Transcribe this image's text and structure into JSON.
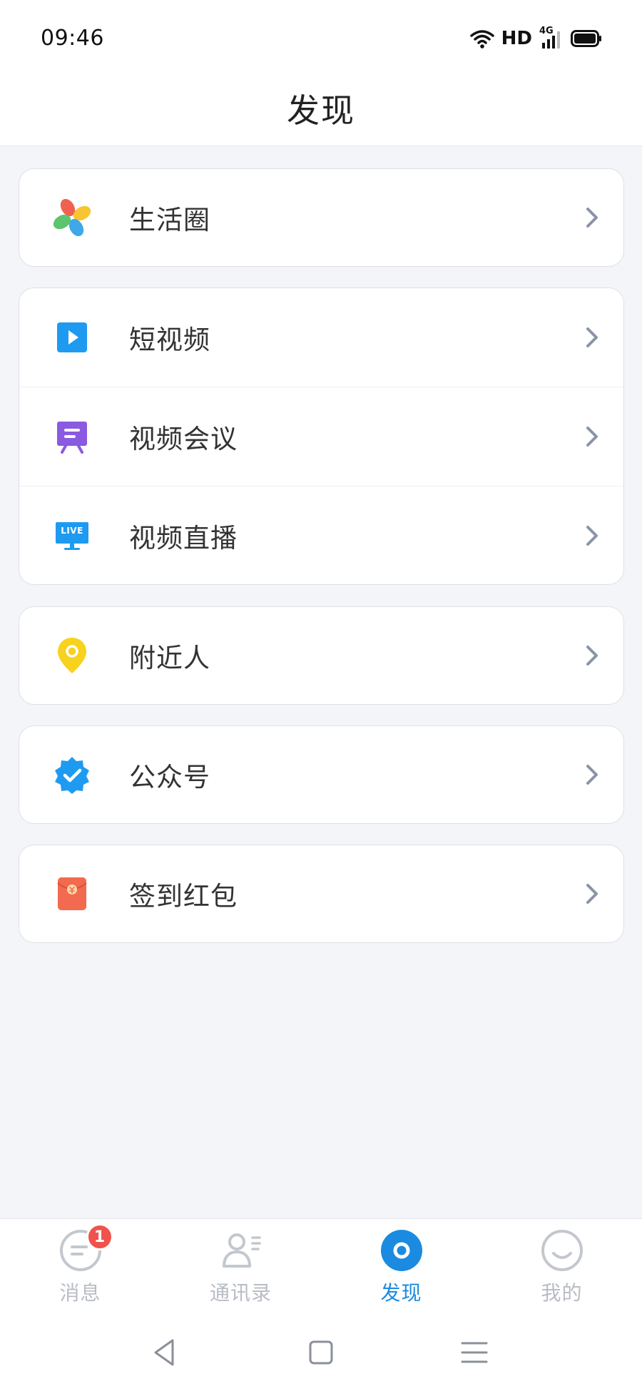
{
  "status_bar": {
    "time": "09:46",
    "network_label": "HD",
    "network_type": "4G"
  },
  "header": {
    "title": "发现"
  },
  "groups": [
    {
      "items": [
        {
          "label": "生活圈",
          "icon": "pinwheel-icon"
        }
      ]
    },
    {
      "items": [
        {
          "label": "短视频",
          "icon": "play-icon"
        },
        {
          "label": "视频会议",
          "icon": "presentation-board-icon"
        },
        {
          "label": "视频直播",
          "icon": "live-tv-icon",
          "icon_text": "LIVE"
        }
      ]
    },
    {
      "items": [
        {
          "label": "附近人",
          "icon": "location-pin-icon"
        }
      ]
    },
    {
      "items": [
        {
          "label": "公众号",
          "icon": "verified-badge-icon"
        }
      ]
    },
    {
      "items": [
        {
          "label": "签到红包",
          "icon": "red-envelope-icon"
        }
      ]
    }
  ],
  "tabbar": {
    "tabs": [
      {
        "label": "消息",
        "icon": "message-icon",
        "badge": "1"
      },
      {
        "label": "通讯录",
        "icon": "contacts-icon"
      },
      {
        "label": "发现",
        "icon": "discover-icon",
        "active": true
      },
      {
        "label": "我的",
        "icon": "profile-smile-icon"
      }
    ]
  },
  "colors": {
    "accent": "#1a8be0",
    "badge": "#f0524c",
    "background": "#f4f5f9"
  }
}
